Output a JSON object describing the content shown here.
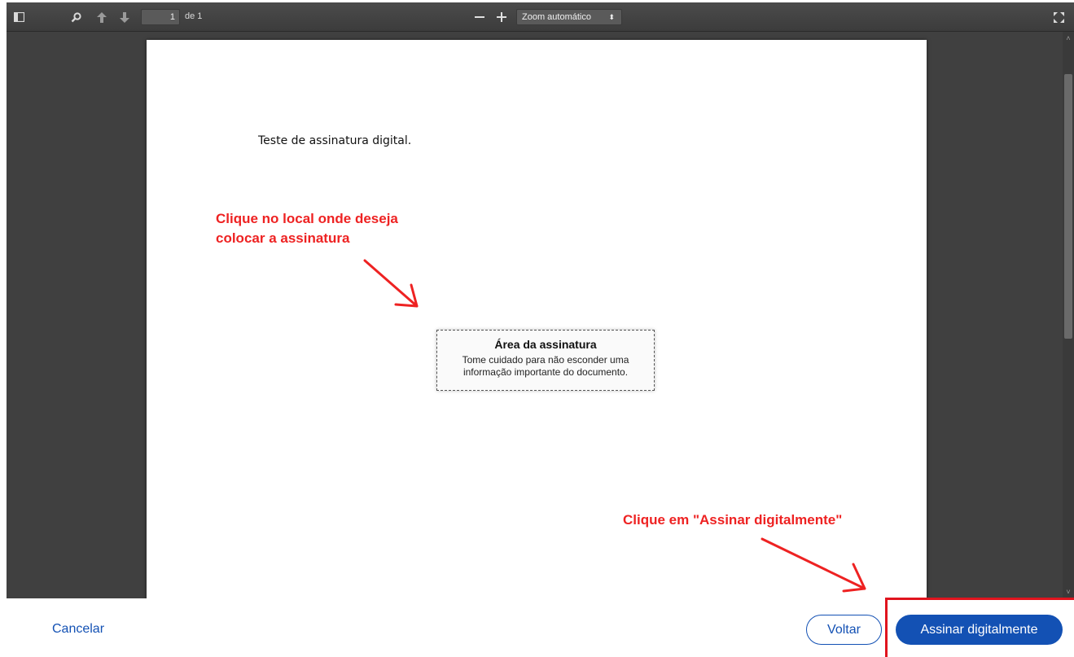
{
  "toolbar": {
    "page_number": "1",
    "page_count": "de 1",
    "zoom_label": "Zoom automático",
    "icons": [
      "sidebar-toggle-icon",
      "search-icon",
      "previous-page-icon",
      "next-page-icon",
      "zoom-out-icon",
      "zoom-in-icon",
      "fullscreen-icon"
    ]
  },
  "document": {
    "text": "Teste de assinatura digital."
  },
  "signature_area": {
    "title": "Área da assinatura",
    "description": "Tome cuidado para não esconder uma informação importante do documento."
  },
  "annotations": {
    "place_signature_line1": "Clique no local onde deseja",
    "place_signature_line2": "colocar a assinatura",
    "click_sign": "Clique em \"Assinar digitalmente\"",
    "color": "#ee2222"
  },
  "footer": {
    "cancel_label": "Cancelar",
    "back_label": "Voltar",
    "sign_label": "Assinar digitalmente",
    "primary_color": "#1351b4"
  }
}
